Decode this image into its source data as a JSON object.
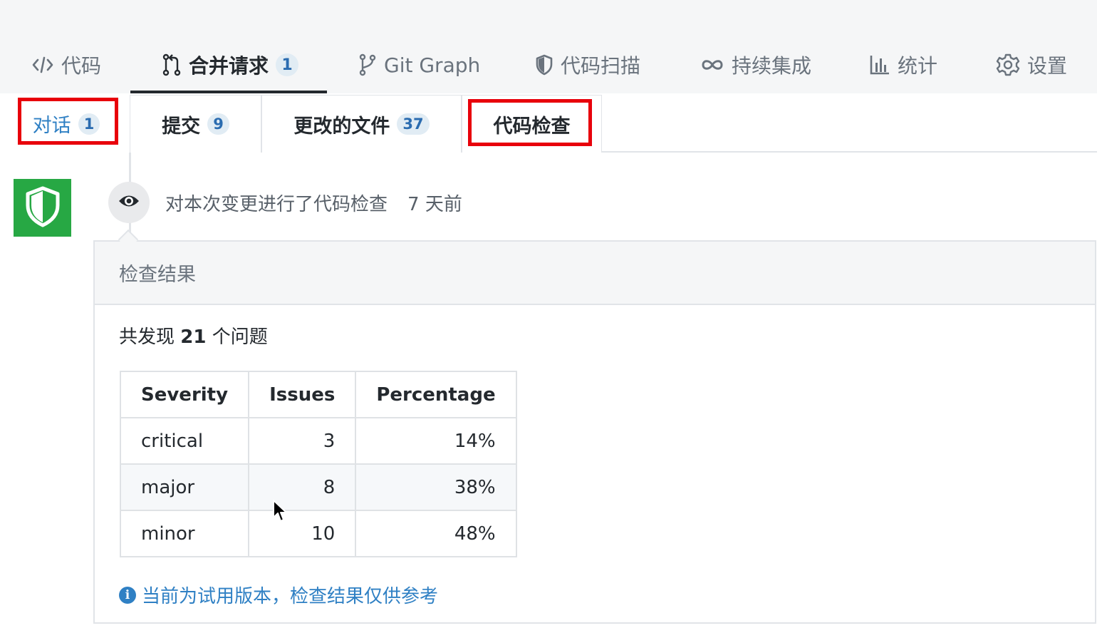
{
  "nav": {
    "items": [
      {
        "icon": "code-icon",
        "label": "代码"
      },
      {
        "icon": "merge-request-icon",
        "label": "合并请求",
        "count": "1"
      },
      {
        "icon": "git-branch-icon",
        "label": "Git Graph"
      },
      {
        "icon": "shield-icon",
        "label": "代码扫描"
      },
      {
        "icon": "infinity-icon",
        "label": "持续集成"
      },
      {
        "icon": "bar-chart-icon",
        "label": "统计"
      },
      {
        "icon": "gear-icon",
        "label": "设置"
      }
    ],
    "active_index": 1
  },
  "subtabs": {
    "items": [
      {
        "label": "对话",
        "count": "1"
      },
      {
        "label": "提交",
        "count": "9"
      },
      {
        "label": "更改的文件",
        "count": "37"
      },
      {
        "label": "代码检查"
      }
    ],
    "active_index": 0,
    "highlighted": [
      "对话",
      "代码检查"
    ]
  },
  "event": {
    "avatar_icon": "shield-icon",
    "badge_icon": "eye-icon",
    "text": "对本次变更进行了代码检查",
    "time": "7 天前"
  },
  "result": {
    "header": "检查结果",
    "summary_prefix": "共发现",
    "summary_count": "21",
    "summary_suffix": "个问题",
    "table": {
      "headers": [
        "Severity",
        "Issues",
        "Percentage"
      ],
      "rows": [
        {
          "severity": "critical",
          "issues": "3",
          "percentage": "14%"
        },
        {
          "severity": "major",
          "issues": "8",
          "percentage": "38%"
        },
        {
          "severity": "minor",
          "issues": "10",
          "percentage": "48%"
        }
      ]
    },
    "notice": "当前为试用版本，检查结果仅供参考"
  },
  "colors": {
    "accent_blue": "#2f80c4",
    "highlight_red": "#e8000b",
    "shield_green": "#27a844"
  }
}
